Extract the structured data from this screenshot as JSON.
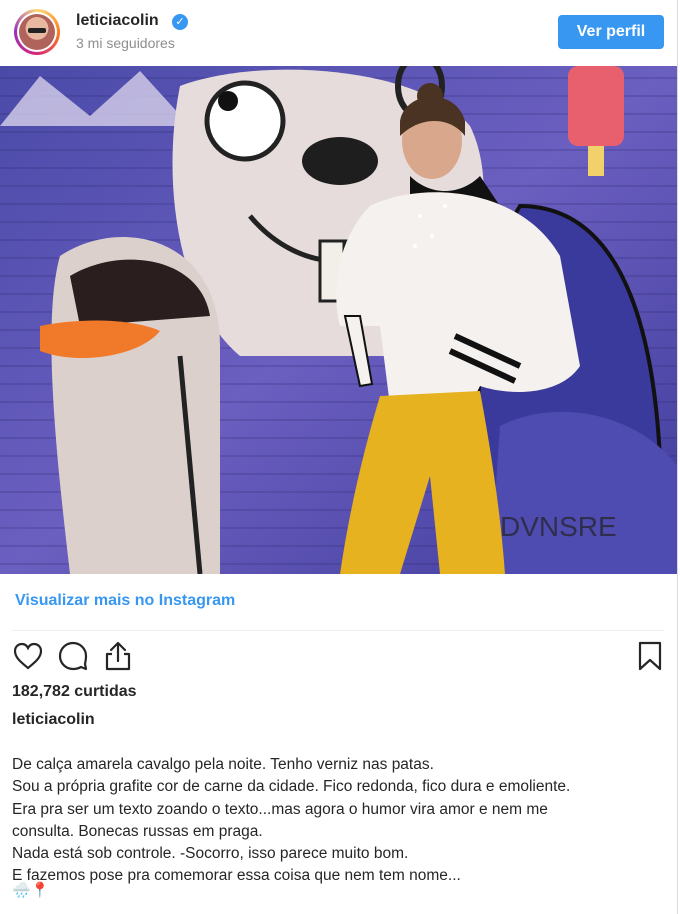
{
  "header": {
    "username": "leticiacolin",
    "followers": "3 mi seguidores",
    "profile_button": "Ver perfil",
    "verified_glyph": "✓"
  },
  "post": {
    "view_more": "Visualizar mais no Instagram",
    "likes": "182,782 curtidas",
    "caption_user": "leticiacolin",
    "caption_lines": [
      "De calça amarela cavalgo pela noite. Tenho verniz nas patas.",
      "Sou a própria grafite cor de carne da cidade. Fico redonda, fico dura e emoliente.",
      "Era pra ser um texto zoando o texto...mas agora o humor vira amor e nem me",
      "consulta. Bonecas russas em praga.",
      "Nada está sob controle. -Socorro, isso parece muito bom.",
      "E fazemos pose pra comemorar essa coisa que nem tem nome..."
    ],
    "emojis": "🌧️📍"
  },
  "icons": {
    "like": "heart-icon",
    "comment": "comment-icon",
    "share": "share-icon",
    "save": "bookmark-icon",
    "verified": "verified-badge-icon"
  },
  "colors": {
    "accent": "#3897f0",
    "text": "#262626",
    "muted": "#8e8e8e"
  }
}
